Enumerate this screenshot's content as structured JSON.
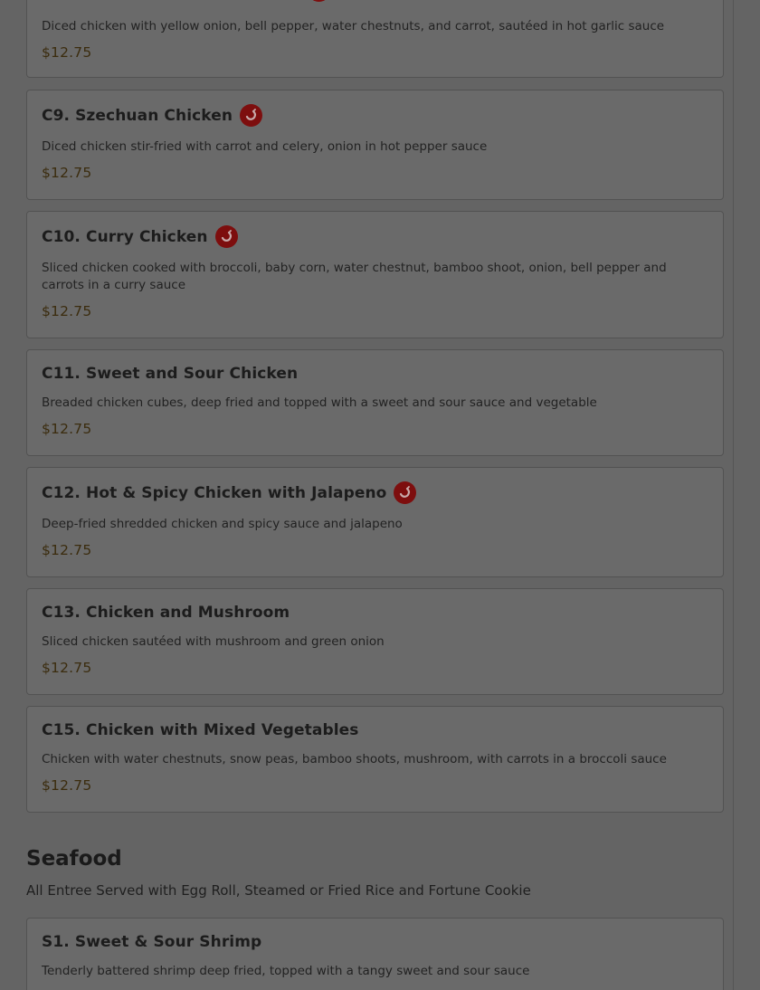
{
  "items": [
    {
      "desc": "Diced chicken with yellow onion, bell pepper, water chestnuts, and carrot, sautéed in hot garlic sauce",
      "price": "$12.75"
    },
    {
      "name": "C9. Szechuan Chicken",
      "spicy": true,
      "desc": "Diced chicken stir-fried with carrot and celery, onion in hot pepper sauce",
      "price": "$12.75"
    },
    {
      "name": "C10. Curry Chicken",
      "spicy": true,
      "desc": "Sliced chicken cooked with broccoli, baby corn, water chestnut, bamboo shoot, onion, bell pepper and carrots in a curry sauce",
      "price": "$12.75"
    },
    {
      "name": "C11. Sweet and Sour Chicken",
      "spicy": false,
      "desc": "Breaded chicken cubes, deep fried and topped with a sweet and sour sauce and vegetable",
      "price": "$12.75"
    },
    {
      "name": "C12. Hot & Spicy Chicken with Jalapeno",
      "spicy": true,
      "desc": "Deep-fried shredded chicken and spicy sauce and jalapeno",
      "price": "$12.75"
    },
    {
      "name": "C13. Chicken and Mushroom",
      "spicy": false,
      "desc": "Sliced chicken sautéed with mushroom and green onion",
      "price": "$12.75"
    },
    {
      "name": "C15. Chicken with Mixed Vegetables",
      "spicy": false,
      "desc": "Chicken with water chestnuts, snow peas, bamboo shoots, mushroom, with carrots in a broccoli sauce",
      "price": "$12.75"
    }
  ],
  "seafood": {
    "title": "Seafood",
    "subtitle": "All Entree Served with Egg Roll, Steamed or Fried Rice and Fortune Cookie",
    "items": [
      {
        "name": "S1. Sweet & Sour Shrimp",
        "spicy": false,
        "desc": "Tenderly battered shrimp deep fried, topped with a tangy sweet and sour sauce"
      }
    ]
  },
  "colors": {
    "spicy_badge": "#7d0e0e",
    "price_text": "#3b2c0e",
    "overlay_background": "#646464"
  },
  "icons": {
    "spicy": "chili-pepper-icon"
  }
}
